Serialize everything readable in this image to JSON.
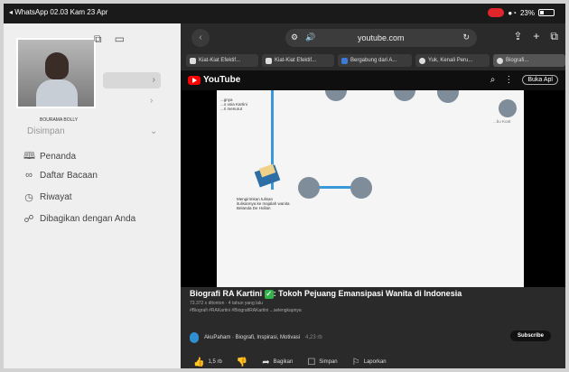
{
  "status": {
    "left": "◂ WhatsApp 02.03 Kam 23 Apr",
    "battery": "23%"
  },
  "sidebar": {
    "thumb_name": "BOURAMA BOLLY",
    "section": "Disimpan",
    "items": [
      {
        "label": "Penanda",
        "icon": "book-icon"
      },
      {
        "label": "Daftar Bacaan",
        "icon": "glasses-icon"
      },
      {
        "label": "Riwayat",
        "icon": "clock-icon"
      },
      {
        "label": "Dibagikan dengan Anda",
        "icon": "shared-icon"
      }
    ]
  },
  "browser": {
    "address": "youtube.com",
    "tabs": [
      "Kiat-Kiat Efektif...",
      "Kiat-Kiat Efektif...",
      "Bergabung dari A...",
      "Yuk, Kenali Peru...",
      "Biografi..."
    ]
  },
  "youtube": {
    "logo": "YouTube",
    "open_app": "Buka Apl",
    "video_text": {
      "top_left": "...gnya\n...o usia Kartini\n...ri menurut",
      "caption": "Mengirimkan tulisan\nitulisannya ke majalah wanita\nBelanda De Hollan",
      "top_right": "...bu Koat"
    },
    "title": "Biografi RA Kartini ",
    "title_after": ": Tokoh Pejuang Emansipasi Wanita di Indonesia",
    "views": "73.372 x ditonton · 4 tahun yang lalu",
    "tags": "#Biografi #RAKartini #BiografiRAKartini ...selengkapnya",
    "channel": "AkuPaham · Biografi, Inspirasi, Motivasi",
    "subs": "4,23 rb",
    "subscribe": "Subscribe",
    "actions": {
      "likes": "1,5 rb",
      "share": "Bagikan",
      "save": "Simpan",
      "report": "Laporkan"
    }
  }
}
